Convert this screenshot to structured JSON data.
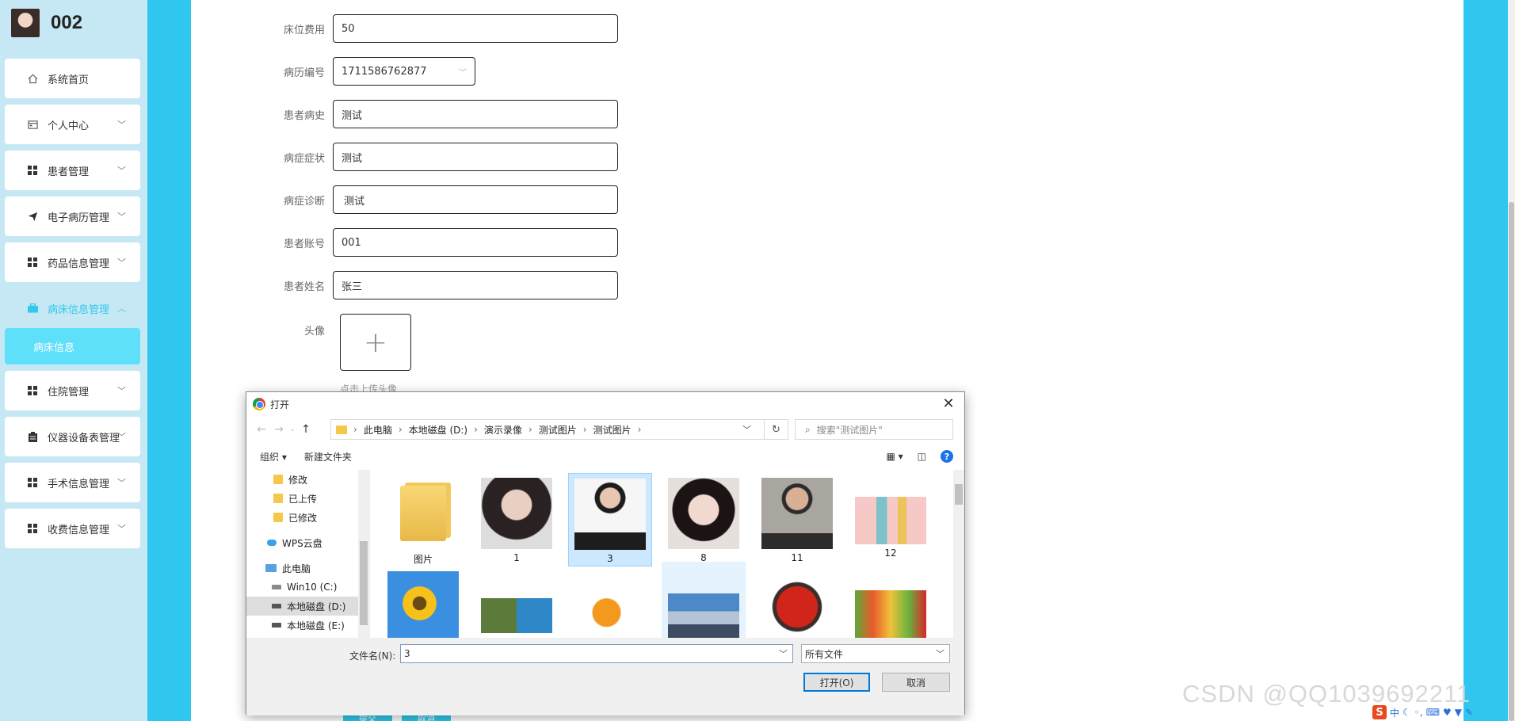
{
  "user": {
    "name": "002"
  },
  "menu": [
    {
      "label": "系统首页",
      "icon": "home-icon",
      "chevron": false
    },
    {
      "label": "个人中心",
      "icon": "calendar-icon",
      "chevron": true
    },
    {
      "label": "患者管理",
      "icon": "grid-icon",
      "chevron": true
    },
    {
      "label": "电子病历管理",
      "icon": "send-icon",
      "chevron": true
    },
    {
      "label": "药品信息管理",
      "icon": "grid-icon",
      "chevron": true
    },
    {
      "label": "病床信息管理",
      "icon": "briefcase-icon",
      "chevron": true,
      "active": true,
      "sub": "病床信息"
    },
    {
      "label": "住院管理",
      "icon": "grid-icon",
      "chevron": true
    },
    {
      "label": "仪器设备表管理",
      "icon": "clipboard-icon",
      "chevron": true
    },
    {
      "label": "手术信息管理",
      "icon": "grid-icon",
      "chevron": true
    },
    {
      "label": "收费信息管理",
      "icon": "grid-icon",
      "chevron": true
    }
  ],
  "form": {
    "bed_fee": {
      "label": "床位费用",
      "value": "50"
    },
    "record_no": {
      "label": "病历编号",
      "value": "1711586762877"
    },
    "history": {
      "label": "患者病史",
      "value": "测试"
    },
    "symptoms": {
      "label": "病症症状",
      "value": "测试"
    },
    "diagnosis": {
      "label": "病症诊断",
      "value": "测试"
    },
    "account": {
      "label": "患者账号",
      "value": "001"
    },
    "name": {
      "label": "患者姓名",
      "value": "张三"
    },
    "avatar": {
      "label": "头像",
      "tip": "点击上传头像"
    },
    "submit": "提交",
    "cancel": "取消"
  },
  "dialog": {
    "title": "打开",
    "path": [
      "此电脑",
      "本地磁盘 (D:)",
      "演示录像",
      "测试图片",
      "测试图片"
    ],
    "search_placeholder": "搜索\"测试图片\"",
    "organize": "组织",
    "new_folder": "新建文件夹",
    "tree": [
      {
        "label": "修改",
        "type": "folder"
      },
      {
        "label": "已上传",
        "type": "folder"
      },
      {
        "label": "已修改",
        "type": "folder"
      },
      {
        "label": "WPS云盘",
        "type": "cloud"
      },
      {
        "label": "此电脑",
        "type": "pc"
      },
      {
        "label": "Win10 (C:)",
        "type": "drive"
      },
      {
        "label": "本地磁盘 (D:)",
        "type": "drive",
        "selected": true
      },
      {
        "label": "本地磁盘 (E:)",
        "type": "drive"
      }
    ],
    "files": [
      {
        "name": "图片",
        "kind": "folder"
      },
      {
        "name": "1",
        "kind": "photo"
      },
      {
        "name": "3",
        "kind": "photo",
        "selected": true
      },
      {
        "name": "8",
        "kind": "photo"
      },
      {
        "name": "11",
        "kind": "photo"
      },
      {
        "name": "12",
        "kind": "photo"
      },
      {
        "name": "",
        "kind": "sunflower"
      },
      {
        "name": "",
        "kind": "campus"
      },
      {
        "name": "",
        "kind": "orange"
      },
      {
        "name": "",
        "kind": "building",
        "hover": true
      },
      {
        "name": "",
        "kind": "strawberry"
      },
      {
        "name": "",
        "kind": "fruits"
      }
    ],
    "filename_label": "文件名(N):",
    "filename_value": "3",
    "filetype": "所有文件",
    "open_button": "打开(O)",
    "cancel_button": "取消"
  },
  "watermark": "CSDN @QQ1039692211",
  "tray": {
    "ime": "中"
  }
}
